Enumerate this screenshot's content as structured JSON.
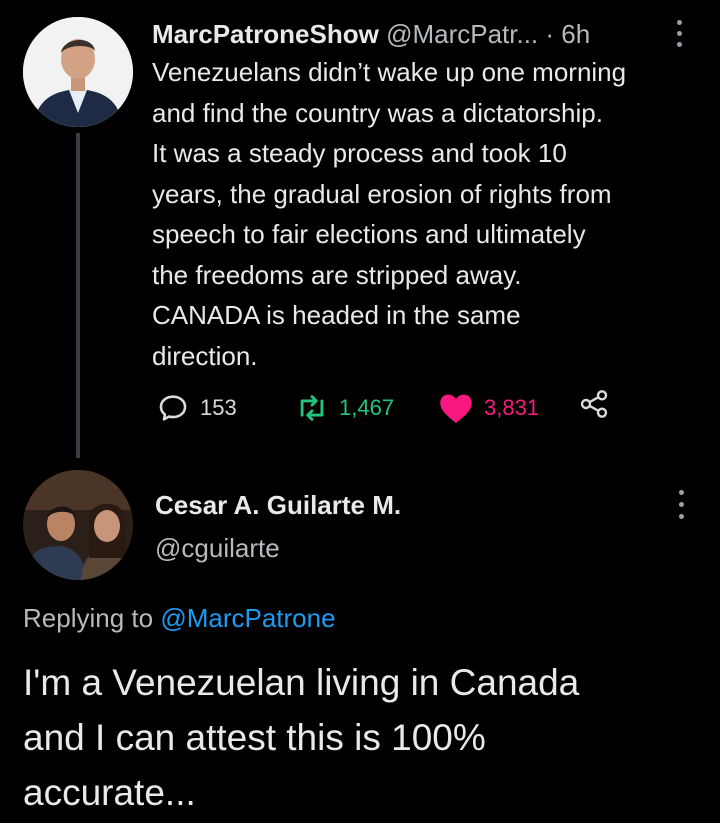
{
  "tweet": {
    "name": "MarcPatroneShow",
    "handle": "@MarcPatr...",
    "time": "· 6h",
    "body": "Venezuelans didn’t wake up one morning\nand find the country was a dictatorship.\nIt was a steady process and took 10\nyears, the gradual erosion of rights from\nspeech to fair elections and ultimately\nthe freedoms are stripped away.\nCANADA is headed in the same\ndirection.",
    "replies": "153",
    "retweets": "1,467",
    "likes": "3,831"
  },
  "reply": {
    "name": "Cesar A. Guilarte M.",
    "handle": "@cguilarte",
    "replying_prefix": "Replying to ",
    "replying_to": "@MarcPatrone",
    "body": "I'm a Venezuelan living in Canada\nand I can attest this is 100%\naccurate..."
  },
  "colors": {
    "background": "#000000",
    "retweet": "#22c47e",
    "like": "#f91880",
    "link": "#1d9bf0"
  },
  "icons": [
    "reply-icon",
    "retweet-icon",
    "heart-icon",
    "share-icon",
    "more-icon"
  ]
}
